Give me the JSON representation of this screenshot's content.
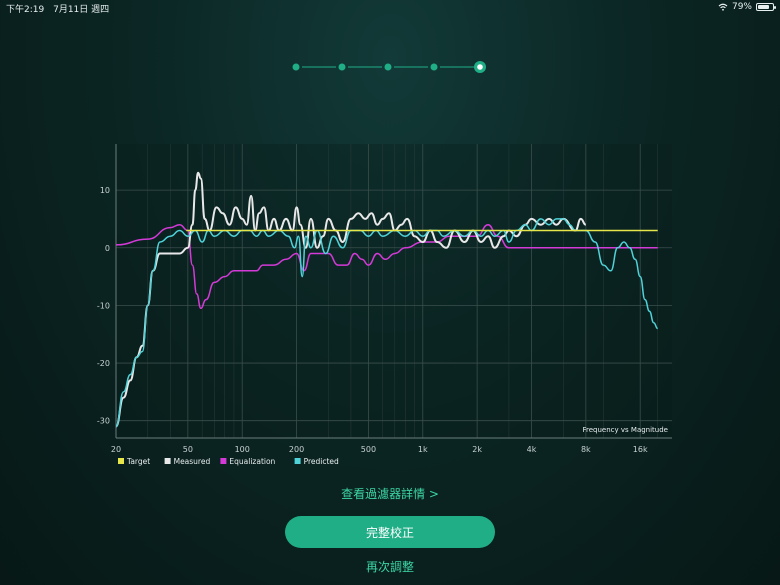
{
  "status_bar": {
    "time": "下午2:19",
    "date": "7月11日 週四",
    "battery_text": "79%",
    "battery_level": 0.79
  },
  "steps": {
    "count": 5,
    "current": 5
  },
  "chart_data": {
    "type": "line",
    "annotation": "Frequency vs Magnitude",
    "x_scale": "log",
    "xlim": [
      20,
      24000
    ],
    "ylim": [
      -33,
      18
    ],
    "x_ticks": [
      20,
      50,
      100,
      200,
      500,
      1000,
      2000,
      4000,
      8000,
      16000
    ],
    "x_tick_labels": [
      "20",
      "50",
      "100",
      "200",
      "500",
      "1k",
      "2k",
      "4k",
      "8k",
      "16k"
    ],
    "y_ticks": [
      10,
      0,
      -10,
      -20,
      -30
    ],
    "y_tick_labels": [
      "10",
      "0",
      "-10",
      "-20",
      "-30"
    ],
    "grid": true,
    "legend_position": "bottom-left",
    "series": [
      {
        "name": "Target",
        "color": "#e6e64a",
        "points": [
          [
            49,
            3
          ],
          [
            20000,
            3
          ]
        ]
      },
      {
        "name": "Measured",
        "color": "#e8e8e8",
        "points": [
          [
            20,
            -31
          ],
          [
            22,
            -26
          ],
          [
            24,
            -23
          ],
          [
            26,
            -19
          ],
          [
            28,
            -17
          ],
          [
            30,
            -10
          ],
          [
            32,
            -4
          ],
          [
            35,
            -1
          ],
          [
            40,
            -1
          ],
          [
            45,
            -1
          ],
          [
            50,
            0
          ],
          [
            53,
            4
          ],
          [
            55,
            10
          ],
          [
            57,
            13
          ],
          [
            59,
            12
          ],
          [
            62,
            5
          ],
          [
            66,
            3
          ],
          [
            72,
            7
          ],
          [
            78,
            6
          ],
          [
            85,
            4
          ],
          [
            92,
            7
          ],
          [
            100,
            5
          ],
          [
            106,
            4
          ],
          [
            112,
            9
          ],
          [
            118,
            3
          ],
          [
            124,
            6
          ],
          [
            132,
            7
          ],
          [
            140,
            3
          ],
          [
            150,
            5
          ],
          [
            160,
            3
          ],
          [
            175,
            5
          ],
          [
            190,
            3
          ],
          [
            200,
            7
          ],
          [
            210,
            4
          ],
          [
            225,
            0
          ],
          [
            240,
            5
          ],
          [
            260,
            0
          ],
          [
            280,
            2
          ],
          [
            300,
            5
          ],
          [
            330,
            3
          ],
          [
            360,
            1
          ],
          [
            400,
            5
          ],
          [
            440,
            6
          ],
          [
            480,
            5
          ],
          [
            520,
            6
          ],
          [
            560,
            4
          ],
          [
            600,
            5
          ],
          [
            650,
            6
          ],
          [
            700,
            3
          ],
          [
            760,
            4
          ],
          [
            820,
            5
          ],
          [
            900,
            2
          ],
          [
            1000,
            1
          ],
          [
            1100,
            3
          ],
          [
            1200,
            1
          ],
          [
            1350,
            0
          ],
          [
            1500,
            3
          ],
          [
            1700,
            1
          ],
          [
            1900,
            3
          ],
          [
            2100,
            1
          ],
          [
            2300,
            2
          ],
          [
            2500,
            0
          ],
          [
            2800,
            2
          ],
          [
            3000,
            3
          ],
          [
            3300,
            2
          ],
          [
            3700,
            4
          ],
          [
            4000,
            5
          ],
          [
            4500,
            4
          ],
          [
            5000,
            5
          ],
          [
            5500,
            4
          ],
          [
            6000,
            5
          ],
          [
            7000,
            3
          ],
          [
            7500,
            5
          ],
          [
            8000,
            4
          ]
        ]
      },
      {
        "name": "Equalization",
        "color": "#d43ad8",
        "points": [
          [
            20,
            0.5
          ],
          [
            30,
            1.5
          ],
          [
            40,
            3.5
          ],
          [
            45,
            4
          ],
          [
            50,
            3
          ],
          [
            53,
            -3
          ],
          [
            56,
            -8
          ],
          [
            59,
            -10.5
          ],
          [
            63,
            -9
          ],
          [
            70,
            -6
          ],
          [
            80,
            -5
          ],
          [
            90,
            -4
          ],
          [
            100,
            -4
          ],
          [
            110,
            -4
          ],
          [
            120,
            -4
          ],
          [
            130,
            -3
          ],
          [
            150,
            -3
          ],
          [
            175,
            -2
          ],
          [
            200,
            -1
          ],
          [
            220,
            -4
          ],
          [
            240,
            -1
          ],
          [
            270,
            -1
          ],
          [
            300,
            -1
          ],
          [
            340,
            -3
          ],
          [
            380,
            -3
          ],
          [
            420,
            -1
          ],
          [
            460,
            -2
          ],
          [
            500,
            -3
          ],
          [
            560,
            -1
          ],
          [
            620,
            -2
          ],
          [
            700,
            -1
          ],
          [
            800,
            0
          ],
          [
            1000,
            1
          ],
          [
            1200,
            1
          ],
          [
            1400,
            2
          ],
          [
            1600,
            2
          ],
          [
            2000,
            2
          ],
          [
            2300,
            4
          ],
          [
            2600,
            2
          ],
          [
            3000,
            0
          ],
          [
            4000,
            0
          ],
          [
            6000,
            0
          ],
          [
            10000,
            0
          ],
          [
            20000,
            0
          ]
        ]
      },
      {
        "name": "Predicted",
        "color": "#4fd2d8",
        "points": [
          [
            20,
            -31
          ],
          [
            22,
            -25
          ],
          [
            24,
            -22
          ],
          [
            26,
            -19
          ],
          [
            28,
            -18
          ],
          [
            30,
            -10
          ],
          [
            32,
            -4
          ],
          [
            35,
            1
          ],
          [
            40,
            2
          ],
          [
            45,
            3
          ],
          [
            50,
            2
          ],
          [
            55,
            3
          ],
          [
            60,
            1
          ],
          [
            65,
            3
          ],
          [
            70,
            2
          ],
          [
            80,
            3
          ],
          [
            90,
            2
          ],
          [
            100,
            3
          ],
          [
            110,
            3
          ],
          [
            120,
            2
          ],
          [
            130,
            3
          ],
          [
            140,
            2
          ],
          [
            160,
            3
          ],
          [
            180,
            2
          ],
          [
            195,
            0
          ],
          [
            205,
            2
          ],
          [
            215,
            -5
          ],
          [
            225,
            2
          ],
          [
            240,
            0
          ],
          [
            260,
            3
          ],
          [
            290,
            -1
          ],
          [
            320,
            2
          ],
          [
            360,
            0
          ],
          [
            400,
            3
          ],
          [
            450,
            3
          ],
          [
            500,
            2
          ],
          [
            550,
            3
          ],
          [
            600,
            2
          ],
          [
            700,
            3
          ],
          [
            800,
            2
          ],
          [
            900,
            3
          ],
          [
            1000,
            2
          ],
          [
            1100,
            3
          ],
          [
            1200,
            3
          ],
          [
            1300,
            2
          ],
          [
            1500,
            3
          ],
          [
            1700,
            2
          ],
          [
            1900,
            3
          ],
          [
            2100,
            2
          ],
          [
            2300,
            3
          ],
          [
            2500,
            2
          ],
          [
            2800,
            3
          ],
          [
            3000,
            1
          ],
          [
            3300,
            3
          ],
          [
            3700,
            4
          ],
          [
            4000,
            3
          ],
          [
            4500,
            5
          ],
          [
            5000,
            4
          ],
          [
            5500,
            5
          ],
          [
            6000,
            5
          ],
          [
            6500,
            4
          ],
          [
            7000,
            3
          ],
          [
            8000,
            3
          ],
          [
            9000,
            1
          ],
          [
            10000,
            -3
          ],
          [
            11000,
            -4
          ],
          [
            12000,
            0
          ],
          [
            13000,
            1
          ],
          [
            14000,
            0
          ],
          [
            15000,
            -2
          ],
          [
            16000,
            -5
          ],
          [
            17000,
            -9
          ],
          [
            18000,
            -11
          ],
          [
            19000,
            -13
          ],
          [
            20000,
            -14
          ]
        ]
      }
    ]
  },
  "actions": {
    "details_link": "查看過濾器詳情 >",
    "primary_button": "完整校正",
    "secondary_link": "再次調整"
  }
}
